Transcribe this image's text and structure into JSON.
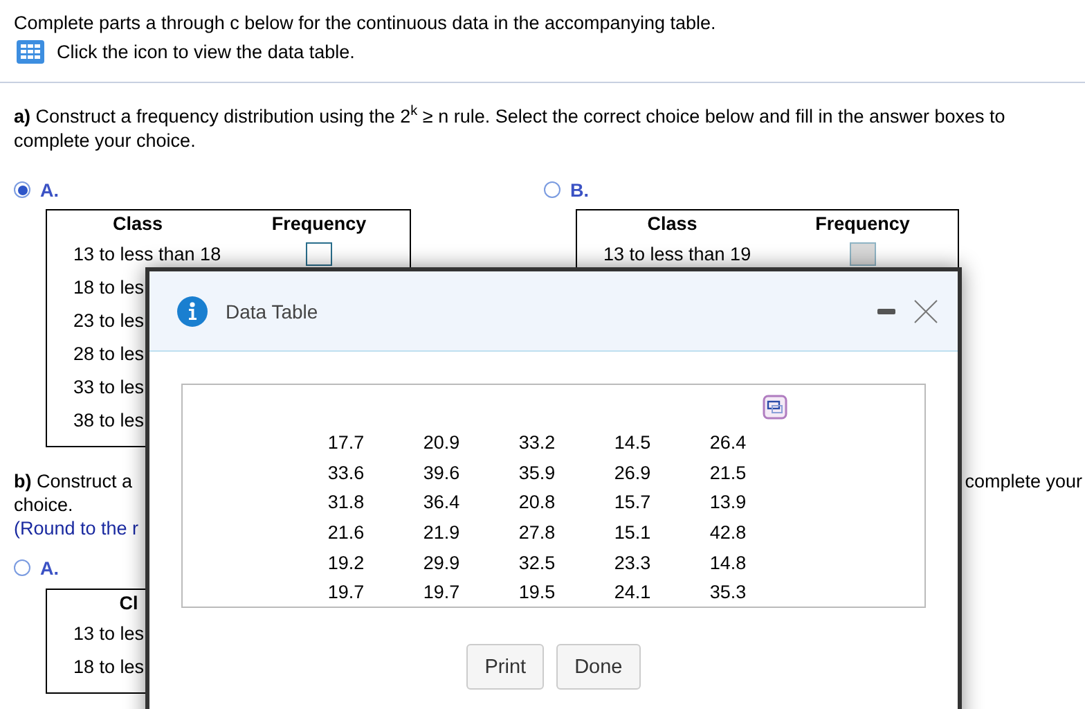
{
  "instructions": "Complete parts a through c below for the continuous data in the accompanying table.",
  "data_table_link": "Click the icon to view the data table.",
  "part_a": {
    "prompt": "**a)** Construct a frequency distribution using the 2$^{k}$ ≥ n rule. Select the correct choice below and fill in the answer boxes to complete your choice.",
    "options": [
      {
        "label": "A.",
        "selected": true,
        "columns": [
          "Class",
          "Frequency"
        ],
        "rows": [
          {
            "class": "13 to less than 18"
          },
          {
            "class": "18 to les"
          },
          {
            "class": "23 to les"
          },
          {
            "class": "28 to les"
          },
          {
            "class": "33 to les"
          },
          {
            "class": "38 to les"
          }
        ]
      },
      {
        "label": "B.",
        "selected": false,
        "columns": [
          "Class",
          "Frequency"
        ],
        "rows": [
          {
            "class": "13 to less than 19"
          }
        ]
      }
    ]
  },
  "part_b": {
    "prompt_start": "**b)** Construct a",
    "prompt_end": "complete your",
    "prompt_line2": "choice.",
    "hint": "(Round to the r",
    "options": [
      {
        "label": "A.",
        "selected": false,
        "columns": [
          "Cl"
        ],
        "rows": [
          {
            "class": "13 to les"
          },
          {
            "class": "18 to les"
          }
        ]
      }
    ]
  },
  "dialog": {
    "title": "Data Table",
    "data": [
      [
        "17.7",
        "20.9",
        "33.2",
        "14.5",
        "26.4"
      ],
      [
        "33.6",
        "39.6",
        "35.9",
        "26.9",
        "21.5"
      ],
      [
        "31.8",
        "36.4",
        "20.8",
        "15.7",
        "13.9"
      ],
      [
        "21.6",
        "21.9",
        "27.8",
        "15.1",
        "42.8"
      ],
      [
        "19.2",
        "29.9",
        "32.5",
        "23.3",
        "14.8"
      ],
      [
        "19.7",
        "19.7",
        "19.5",
        "24.1",
        "35.3"
      ]
    ],
    "buttons": [
      "Print",
      "Done"
    ]
  }
}
